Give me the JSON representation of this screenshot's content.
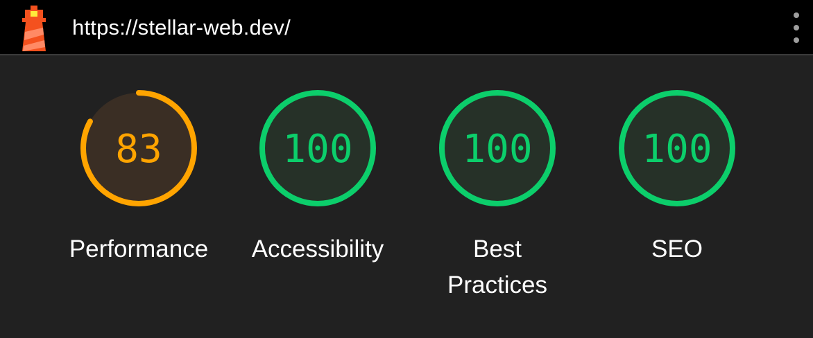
{
  "header": {
    "url": "https://stellar-web.dev/",
    "logo_icon": "lighthouse-icon",
    "menu_icon": "more-vertical-icon"
  },
  "colors": {
    "average": "#ffa400",
    "pass": "#0cce6b",
    "average_fill": "#3a2e24",
    "pass_fill": "#263128"
  },
  "gauges": [
    {
      "label": "Performance",
      "score": "83",
      "value": 83,
      "rating": "average"
    },
    {
      "label": "Accessibility",
      "score": "100",
      "value": 100,
      "rating": "pass"
    },
    {
      "label": "Best Practices",
      "score": "100",
      "value": 100,
      "rating": "pass"
    },
    {
      "label": "SEO",
      "score": "100",
      "value": 100,
      "rating": "pass"
    }
  ]
}
